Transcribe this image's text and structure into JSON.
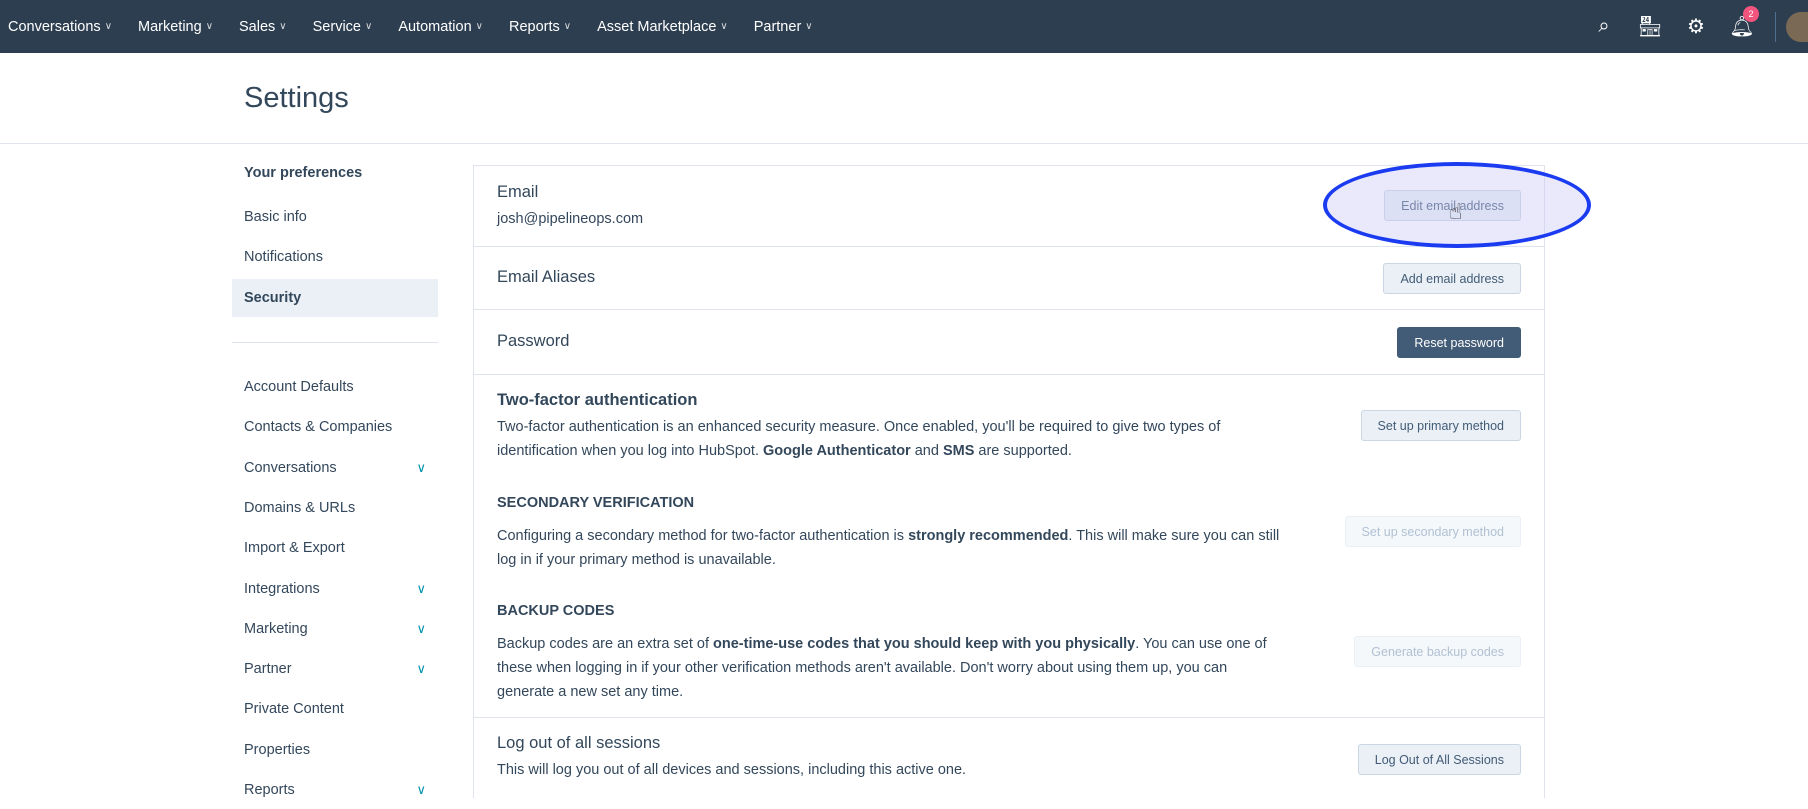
{
  "nav": {
    "items": [
      "Conversations",
      "Marketing",
      "Sales",
      "Service",
      "Automation",
      "Reports",
      "Asset Marketplace",
      "Partner"
    ],
    "notification_count": "2",
    "icons": [
      "search-icon",
      "marketplace-icon",
      "gear-icon",
      "bell-icon"
    ]
  },
  "page": {
    "title": "Settings"
  },
  "sidebar": {
    "section_title": "Your preferences",
    "pref_items": [
      "Basic info",
      "Notifications",
      "Security"
    ],
    "active": "Security",
    "account_items": [
      {
        "label": "Account Defaults",
        "expandable": false
      },
      {
        "label": "Contacts & Companies",
        "expandable": false
      },
      {
        "label": "Conversations",
        "expandable": true
      },
      {
        "label": "Domains & URLs",
        "expandable": false
      },
      {
        "label": "Import & Export",
        "expandable": false
      },
      {
        "label": "Integrations",
        "expandable": true
      },
      {
        "label": "Marketing",
        "expandable": true
      },
      {
        "label": "Partner",
        "expandable": true
      },
      {
        "label": "Private Content",
        "expandable": false
      },
      {
        "label": "Properties",
        "expandable": false
      },
      {
        "label": "Reports",
        "expandable": true
      }
    ]
  },
  "security": {
    "email": {
      "title": "Email",
      "value": "josh@pipelineops.com",
      "button": "Edit email address"
    },
    "aliases": {
      "title": "Email Aliases",
      "button": "Add email address"
    },
    "password": {
      "title": "Password",
      "button": "Reset password"
    },
    "twofa": {
      "title": "Two-factor authentication",
      "desc_1": "Two-factor authentication is an enhanced security measure. Once enabled, you'll be required to give two types of identification when you log into HubSpot. ",
      "desc_b1": "Google Authenticator",
      "desc_2": " and ",
      "desc_b2": "SMS",
      "desc_3": " are supported.",
      "button": "Set up primary method"
    },
    "secondary": {
      "title": "SECONDARY VERIFICATION",
      "desc_1": "Configuring a secondary method for two-factor authentication is ",
      "desc_b": "strongly recommended",
      "desc_2": ". This will make sure you can still log in if your primary method is unavailable.",
      "button": "Set up secondary method"
    },
    "backup": {
      "title": "BACKUP CODES",
      "desc_1": "Backup codes are an extra set of ",
      "desc_b": "one-time-use codes that you should keep with you physically",
      "desc_2": ". You can use one of these when logging in if your other verification methods aren't available. Don't worry about using them up, you can generate a new set any time.",
      "button": "Generate backup codes"
    },
    "logout": {
      "title": "Log out of all sessions",
      "desc": "This will log you out of all devices and sessions, including this active one.",
      "button": "Log Out of All Sessions"
    }
  },
  "colors": {
    "nav": "#2d3e50",
    "accent": "#0091ae",
    "dark_button": "#425b76",
    "highlight": "#1a3bf0"
  }
}
